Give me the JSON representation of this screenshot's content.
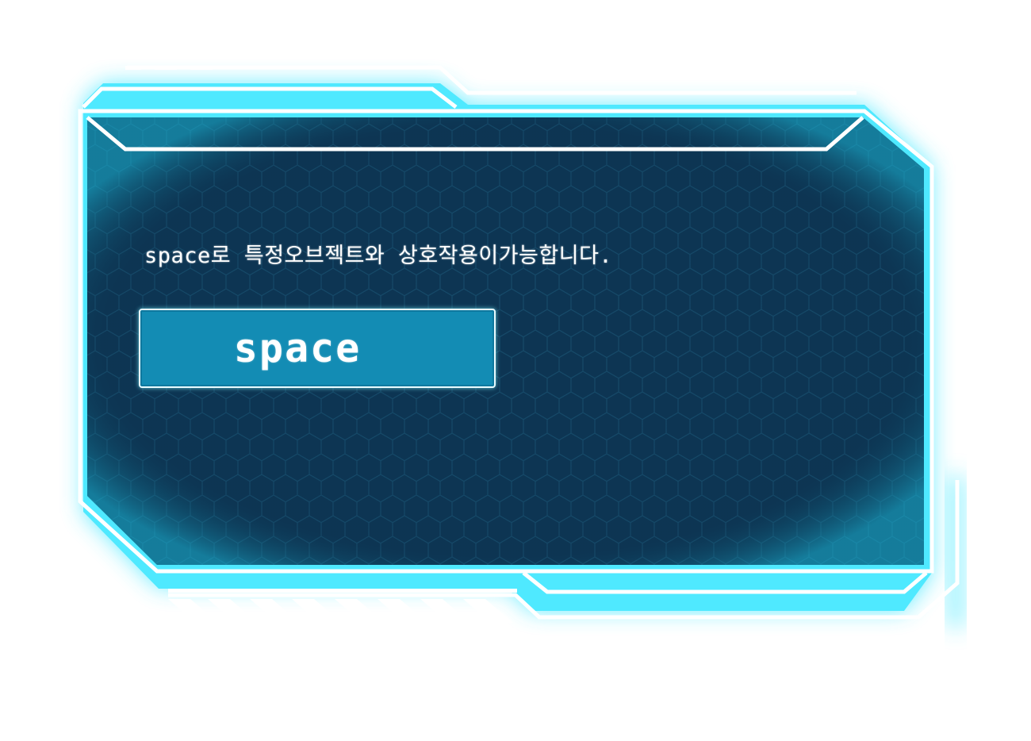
{
  "panel": {
    "message": "space로 특정오브젝트와 상호작용이가능합니다."
  },
  "key_prompt": {
    "label": "space"
  },
  "colors": {
    "panel_fill": "#0d3553",
    "glow": "#39e6ff",
    "frame_line": "#ffffff",
    "button_fill": "#138cb4"
  }
}
